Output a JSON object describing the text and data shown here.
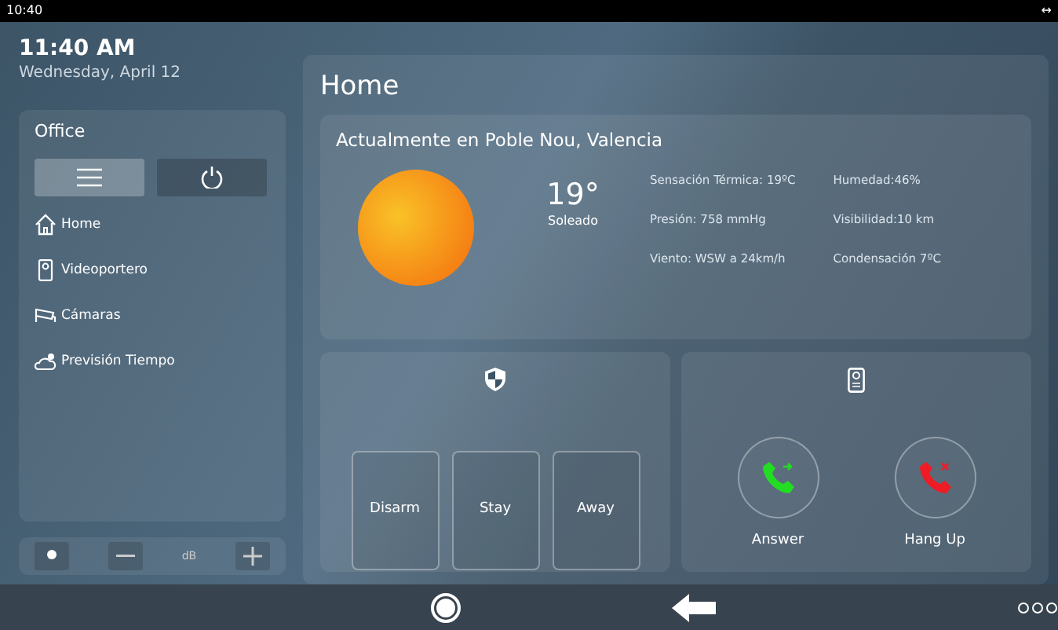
{
  "status_bar": {
    "time": "10:40",
    "indicator": "↔"
  },
  "clock": {
    "time": "11:40 AM",
    "date": "Wednesday, April 12"
  },
  "sidebar": {
    "title": "Office",
    "toggles": [
      {
        "kind": "menu",
        "selected": true
      },
      {
        "kind": "power",
        "selected": false
      }
    ],
    "items": [
      {
        "kind": "home",
        "label": "Home"
      },
      {
        "kind": "doorphone",
        "label": "Videoportero"
      },
      {
        "kind": "camera",
        "label": "Cámaras"
      },
      {
        "kind": "weather",
        "label": "Previsión Tiempo"
      }
    ]
  },
  "volume": {
    "unit": "dB"
  },
  "page": {
    "title": "Home"
  },
  "weather": {
    "location": "Actualmente en Poble Nou, Valencia",
    "temperature": "19°",
    "condition": "Soleado",
    "details": [
      [
        "Sensación Térmica: 19ºC",
        "Presión:  758 mmHg",
        "Viento:  WSW a 24km/h"
      ],
      [
        "Humedad:46%",
        "Visibilidad:10 km",
        "Condensación  7ºC"
      ]
    ]
  },
  "alarm": {
    "buttons": [
      "Disarm",
      "Stay",
      "Away"
    ]
  },
  "intercom": {
    "actions": [
      {
        "kind": "answer",
        "label": "Answer",
        "color": "#22dd22"
      },
      {
        "kind": "hangup",
        "label": "Hang Up",
        "color": "#ee1c24"
      }
    ]
  }
}
